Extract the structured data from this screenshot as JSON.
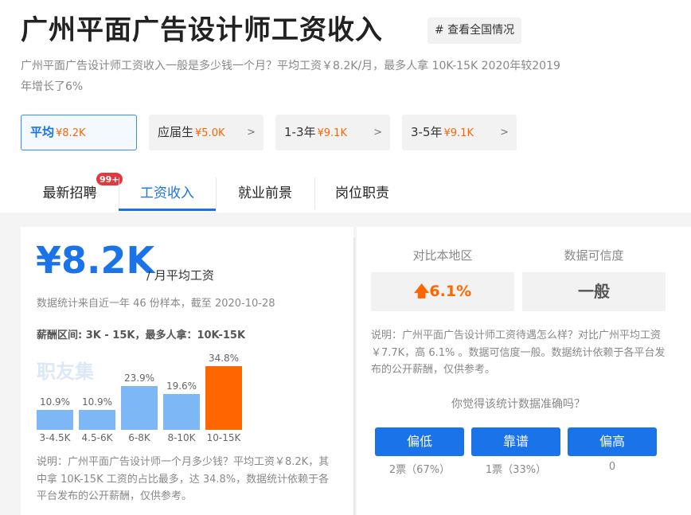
{
  "header": {
    "title": "广州平面广告设计师工资收入",
    "view_all_label": "# 查看全国情况",
    "subtitle": "广州平面广告设计师工资收入一般是多少钱一个月？平均工资￥8.2K/月，最多人拿 10K-15K 2020年较2019年增长了6%"
  },
  "pills": [
    {
      "label": "平均",
      "amount": "¥8.2K"
    },
    {
      "label": "应届生",
      "amount": "¥5.0K"
    },
    {
      "label": "1-3年",
      "amount": "¥9.1K"
    },
    {
      "label": "3-5年",
      "amount": "¥9.1K"
    }
  ],
  "tabs": [
    {
      "label": "最新招聘",
      "badge": "99+"
    },
    {
      "label": "工资收入"
    },
    {
      "label": "就业前景"
    },
    {
      "label": "岗位职责"
    }
  ],
  "salary": {
    "amount": "¥8.2K",
    "unit": "/ 月平均工资",
    "sample_note": "数据统计来自近一年 46 份样本，截至 2020-10-28",
    "range_line": "薪酬区间: 3K - 15K，最多人拿：10K-15K",
    "watermark": "职友集"
  },
  "chart_data": {
    "type": "bar",
    "categories": [
      "3-4.5K",
      "4.5-6K",
      "6-8K",
      "8-10K",
      "10-15K"
    ],
    "values": [
      10.9,
      10.9,
      23.9,
      19.6,
      34.8
    ],
    "value_labels": [
      "10.9%",
      "10.9%",
      "23.9%",
      "19.6%",
      "34.8%"
    ],
    "highlight_index": 4,
    "colors": {
      "default": "#7db7f5",
      "highlight": "#ff6600"
    }
  },
  "left_desc": "说明：广州平面广告设计师一个月多少钱？平均工资￥8.2K，其中拿 10K-15K 工资的占比最多，达 34.8%，数据统计依赖于各平台发布的公开薪酬，仅供参考。",
  "compare": {
    "local_head": "对比本地区",
    "local_value": "6.1%",
    "reliability_head": "数据可信度",
    "reliability_value": "一般"
  },
  "right_desc": "说明：广州平面广告设计师工资待遇怎么样？对比广州平均工资 ￥7.7K，高 6.1% 。数据可信度一般。数据统计依赖于各平台发布的公开薪酬，仅供参考。",
  "vote": {
    "question": "你觉得该统计数据准确吗？",
    "options": [
      {
        "label": "偏低",
        "count": "2票（67%）"
      },
      {
        "label": "靠谱",
        "count": "1票（33%）"
      },
      {
        "label": "偏高",
        "count": "0"
      }
    ]
  },
  "colors": {
    "accent": "#1a73e8",
    "highlight": "#ff6600",
    "badge": "#e4393c"
  }
}
